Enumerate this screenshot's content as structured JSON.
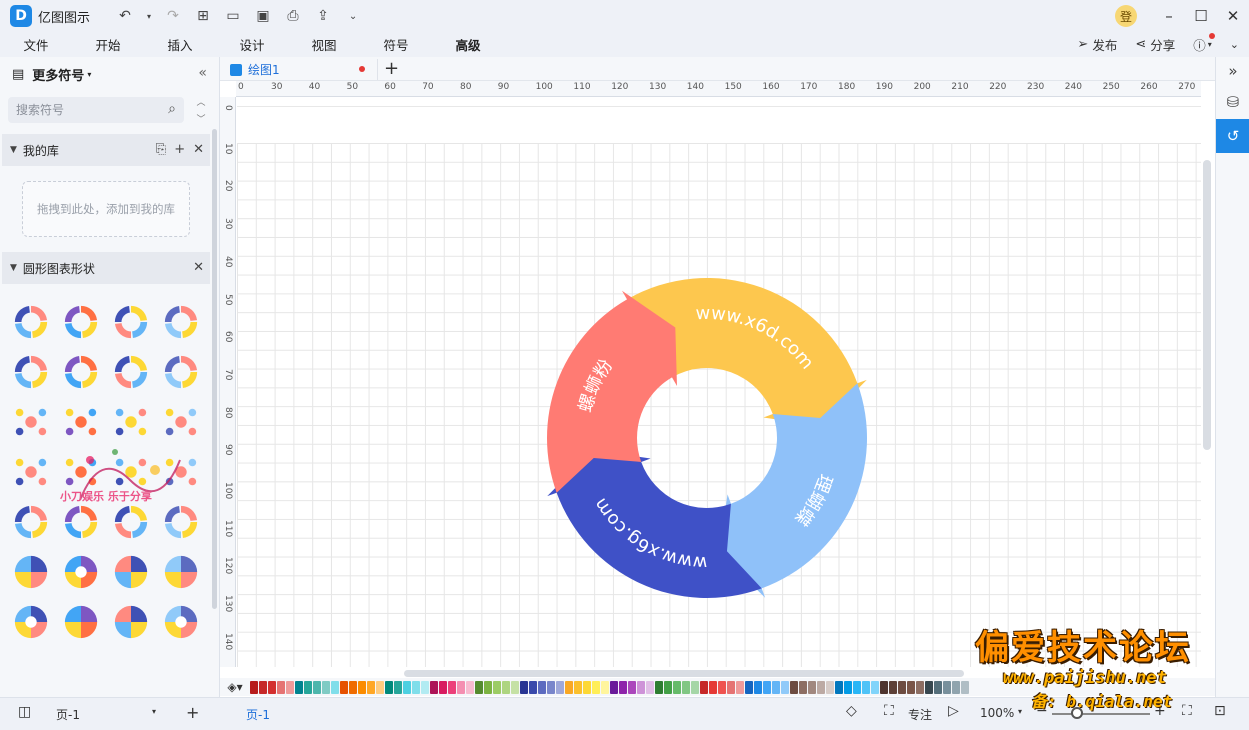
{
  "app": {
    "title": "亿图图示",
    "logo_letter": "D",
    "user_initial": "登"
  },
  "menu": [
    "文件",
    "开始",
    "插入",
    "设计",
    "视图",
    "符号",
    "高级"
  ],
  "menu_right": {
    "publish": "发布",
    "share": "分享"
  },
  "left_panel": {
    "title": "更多符号",
    "search_placeholder": "搜索符号",
    "my_library": "我的库",
    "drop_hint": "拖拽到此处，添加到我的库",
    "shape_category": "圆形图表形状"
  },
  "document": {
    "tab": "绘图1"
  },
  "ruler": {
    "top": [
      "0",
      "30",
      "40",
      "50",
      "60",
      "70",
      "80",
      "90",
      "100",
      "110",
      "120",
      "130",
      "140",
      "150",
      "160",
      "170",
      "180",
      "190",
      "200",
      "210",
      "220",
      "230",
      "240",
      "250",
      "260",
      "270"
    ],
    "left": [
      "0",
      "10",
      "20",
      "30",
      "40",
      "50",
      "60",
      "70",
      "80",
      "90",
      "100",
      "110",
      "120",
      "130",
      "140"
    ]
  },
  "diagram": {
    "segments": [
      {
        "label": "www.x6d.com",
        "color": "#fdc74e"
      },
      {
        "label": "理蝴蝶",
        "color": "#8fc1f9"
      },
      {
        "label": "www.x6g.com",
        "color": "#3f51c7"
      },
      {
        "label": "螺蛳粉",
        "color": "#ff7b73"
      }
    ]
  },
  "status": {
    "page_selector": "页-1",
    "page_tab": "页-1",
    "focus": "专注",
    "zoom": "100%"
  },
  "watermark": {
    "title": "偏爱技术论坛",
    "url": "www.paijishu.net",
    "url2": "备: b.qiala.net"
  },
  "watermark2": {
    "text": "小刀娱乐 乐于分享"
  },
  "palette": [
    "#b71c1c",
    "#c62828",
    "#d32f2f",
    "#e57373",
    "#ef9a9a",
    "#00838f",
    "#26a69a",
    "#4db6ac",
    "#80cbc4",
    "#80deea",
    "#e65100",
    "#ef6c00",
    "#fb8c00",
    "#ffa726",
    "#ffcc80",
    "#00897b",
    "#26a69a",
    "#4dd0e1",
    "#80deea",
    "#b2ebf2",
    "#ad1457",
    "#d81b60",
    "#ec407a",
    "#f48fb1",
    "#f8bbd0",
    "#558b2f",
    "#7cb342",
    "#9ccc65",
    "#aed581",
    "#c5e1a5",
    "#283593",
    "#3949ab",
    "#5c6bc0",
    "#7986cb",
    "#9fa8da",
    "#f9a825",
    "#fbc02d",
    "#fdd835",
    "#ffee58",
    "#fff59d",
    "#6a1b9a",
    "#8e24aa",
    "#ab47bc",
    "#ce93d8",
    "#e1bee7",
    "#2e7d32",
    "#43a047",
    "#66bb6a",
    "#81c784",
    "#a5d6a7",
    "#c62828",
    "#e53935",
    "#ef5350",
    "#e57373",
    "#ef9a9a",
    "#1565c0",
    "#1e88e5",
    "#42a5f5",
    "#64b5f6",
    "#90caf9",
    "#6d4c41",
    "#8d6e63",
    "#a1887f",
    "#bcaaa4",
    "#d7ccc8",
    "#0277bd",
    "#039be5",
    "#29b6f6",
    "#4fc3f7",
    "#81d4fa",
    "#4e342e",
    "#5d4037",
    "#6d4c41",
    "#795548",
    "#8d6e63",
    "#37474f",
    "#546e7a",
    "#78909c",
    "#90a4ae",
    "#b0bec5"
  ]
}
